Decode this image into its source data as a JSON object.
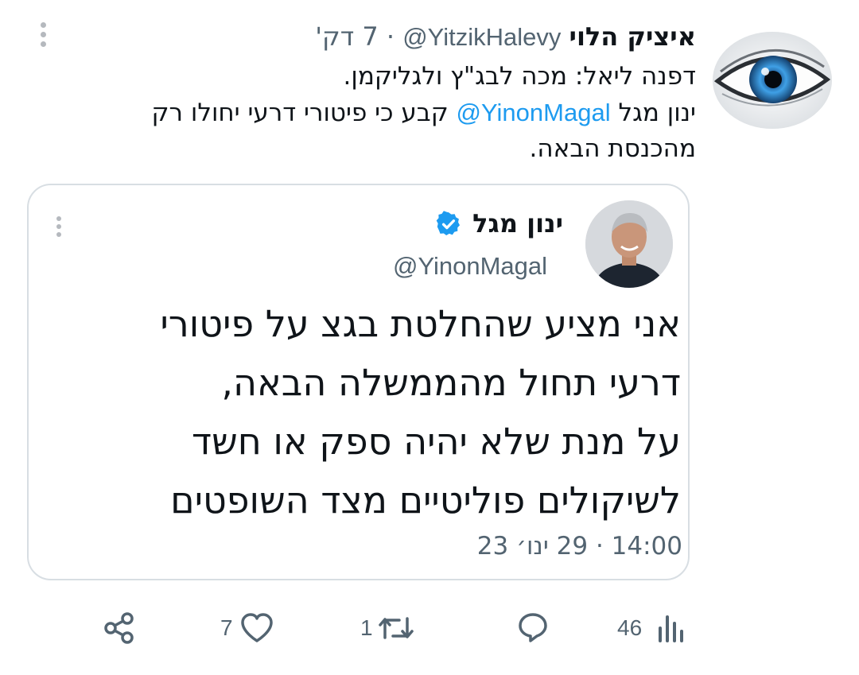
{
  "tweet": {
    "author_name": "איציק הלוי",
    "author_handle": "@YitzikHalevy",
    "separator": "·",
    "time_ago": "7 דק'",
    "text_line1": "דפנה ליאל: מכה לבג\"ץ ולגליקמן.",
    "text_line2_before": "ינון מגל ",
    "mention": "@YinonMagal",
    "text_line2_after": " קבע כי פיטורי דרעי יחולו רק",
    "text_line3": "מהכנסת הבאה."
  },
  "quoted_tweet": {
    "author_name": "ינון מגל",
    "author_handle": "@YinonMagal",
    "verified": true,
    "body_lines": [
      "אני מציע שהחלטת בגצ על פיטורי",
      "דרעי תחול מהממשלה הבאה,",
      "על מנת שלא יהיה ספק או חשד",
      "לשיקולים פוליטיים מצד השופטים"
    ],
    "timestamp": "14:00 · 29 ינו׳ 23"
  },
  "actions": {
    "views_count": "46",
    "replies_count": "",
    "retweets_count": "1",
    "likes_count": "7"
  },
  "colors": {
    "link": "#1d9bf0",
    "muted": "#536471",
    "icon": "#536471",
    "verified": "#1d9bf0"
  },
  "icons": {
    "views": "views-icon",
    "reply": "reply-icon",
    "retweet": "retweet-icon",
    "like": "heart-icon",
    "share": "share-icon",
    "more": "more-vertical-icon",
    "verified": "verified-badge-icon"
  }
}
